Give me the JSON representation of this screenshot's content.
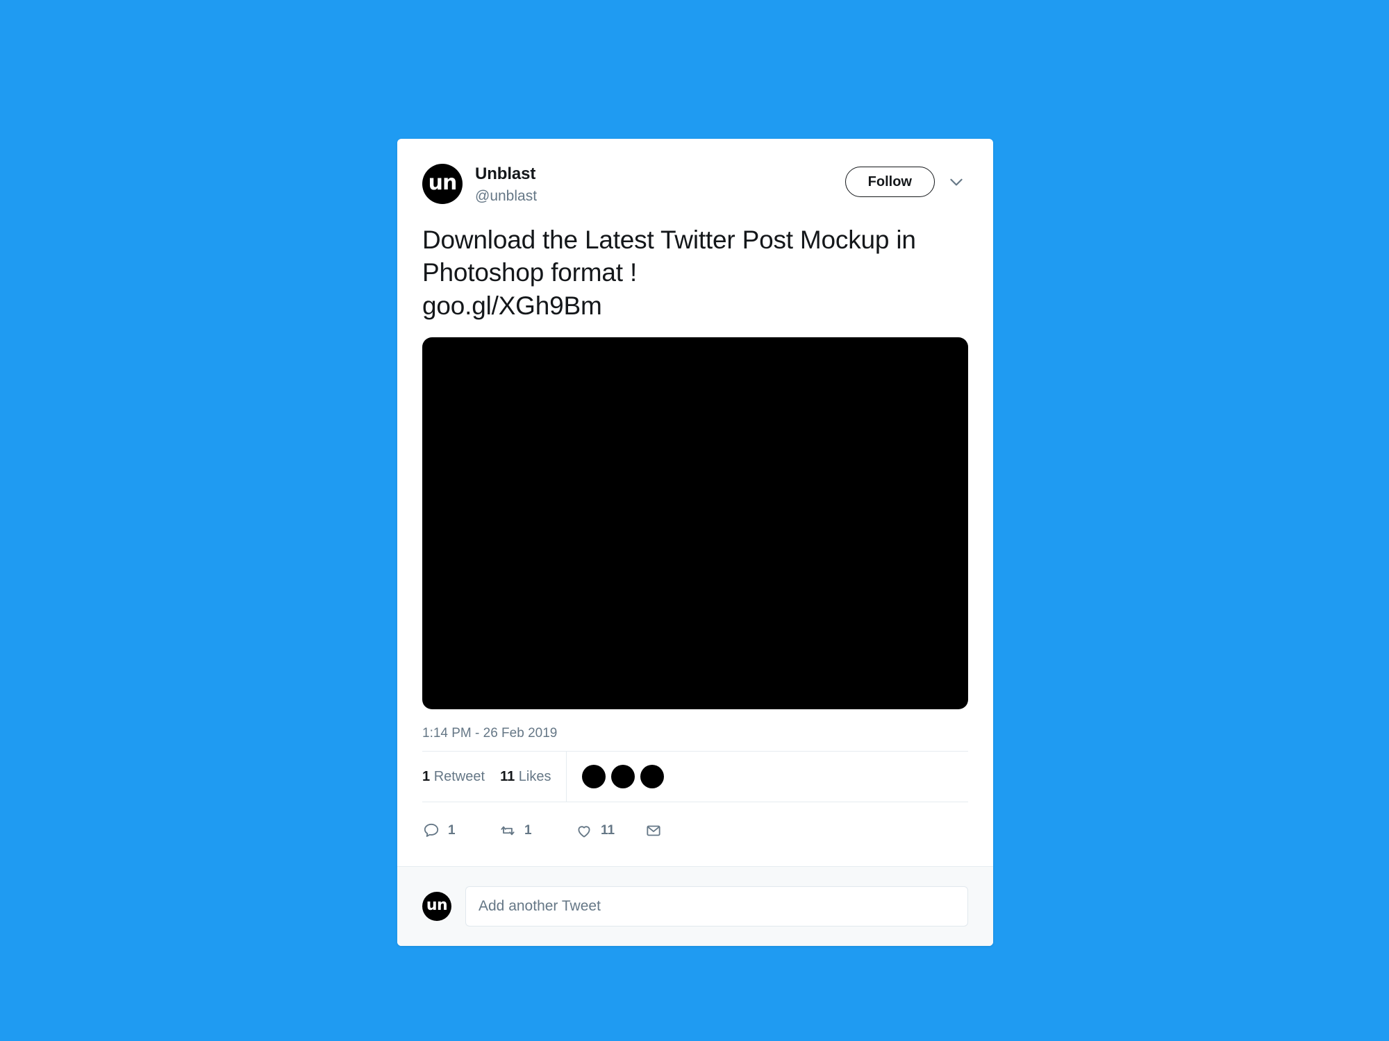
{
  "theme": {
    "background_color": "#1F9BF2",
    "card_background": "#FFFFFF",
    "text_primary": "#14171A",
    "text_secondary": "#657786",
    "border_color": "#E6ECF0",
    "composer_background": "#F7F9FA",
    "avatar_color": "#000000",
    "media_color": "#000000"
  },
  "tweet": {
    "author": {
      "display_name": "Unblast",
      "handle": "@unblast",
      "avatar_logo": "un",
      "avatar_icon": "unblast-logo-icon"
    },
    "follow_button_label": "Follow",
    "caret_icon": "chevron-down-icon",
    "text": "Download the Latest Twitter Post Mockup in Photoshop format !\ngoo.gl/XGh9Bm",
    "media": {
      "icon": "tweet-image-placeholder",
      "alt": ""
    },
    "timestamp": "1:14 PM - 26 Feb 2019",
    "stats": {
      "retweet_count": "1",
      "retweet_label": "Retweet",
      "like_count": "11",
      "like_label": "Likes",
      "liker_avatars": [
        "liker-avatar-1",
        "liker-avatar-2",
        "liker-avatar-3"
      ]
    },
    "actions": [
      {
        "name": "reply",
        "icon": "reply-icon",
        "count": "1"
      },
      {
        "name": "retweet",
        "icon": "retweet-icon",
        "count": "1"
      },
      {
        "name": "like",
        "icon": "heart-icon",
        "count": "11"
      },
      {
        "name": "direct-message",
        "icon": "envelope-icon",
        "count": ""
      }
    ]
  },
  "composer": {
    "avatar_logo": "un",
    "placeholder": "Add another Tweet",
    "value": ""
  }
}
